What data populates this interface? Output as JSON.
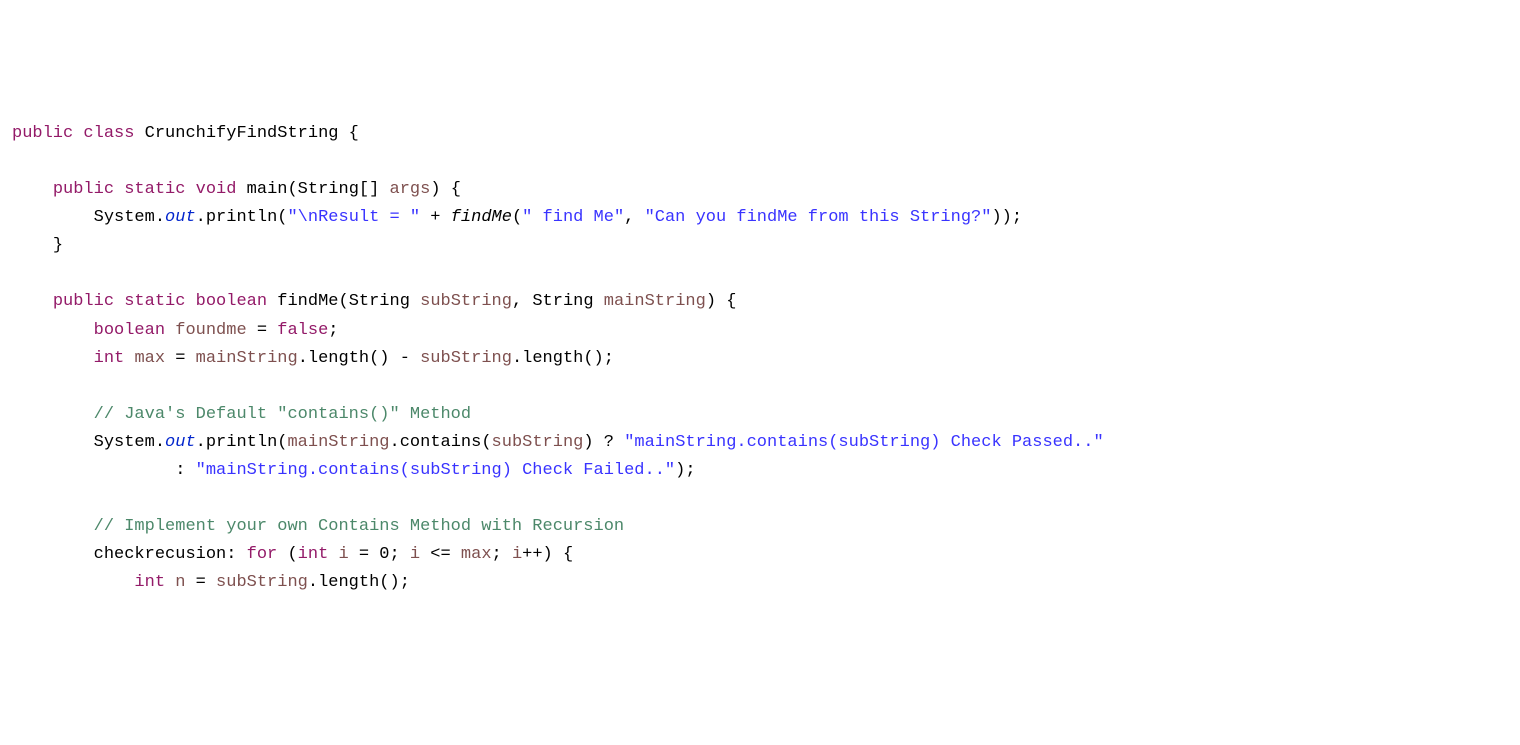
{
  "code": {
    "kw_public1": "public",
    "kw_class": "class",
    "classname": "CrunchifyFindString",
    "brace_open1": " {",
    "blank": "",
    "indent1": "    ",
    "kw_public2": "public",
    "kw_static1": "static",
    "kw_void": "void",
    "main_name": "main",
    "main_params_open": "(String[] ",
    "args": "args",
    "main_params_close": ") {",
    "indent2": "        ",
    "system1": "System.",
    "out1": "out",
    "println1": ".println(",
    "str1": "\"\\nResult = \"",
    "plus1": " + ",
    "findMe_call": "findMe",
    "call_open": "(",
    "str2": "\" find Me\"",
    "comma1": ", ",
    "str3": "\"Can you findMe from this String?\"",
    "call_close": "));",
    "close_brace1": "}",
    "kw_public3": "public",
    "kw_static2": "static",
    "kw_boolean": "boolean",
    "findMe_name": "findMe",
    "findMe_open": "(String ",
    "subString": "subString",
    "comma2": ", String ",
    "mainString": "mainString",
    "findMe_close": ") {",
    "kw_boolean2": "boolean",
    "foundme": "foundme",
    "eq_false": " = ",
    "kw_false": "false",
    "semi1": ";",
    "kw_int1": "int",
    "max": "max",
    "eq1": " = ",
    "mainString2": "mainString",
    "length1": ".length() - ",
    "subString2": "subString",
    "length2": ".length();",
    "comment1": "// Java's Default \"contains()\" Method",
    "system2": "System.",
    "out2": "out",
    "println2": ".println(",
    "mainString3": "mainString",
    "contains1": ".contains(",
    "subString3": "subString",
    "ternary1": ") ? ",
    "str4": "\"mainString.contains(subString) Check Passed..\"",
    "indent3": "                ",
    "colon1": ": ",
    "str5": "\"mainString.contains(subString) Check Failed..\"",
    "close_paren1": ");",
    "comment2": "// Implement your own Contains Method with Recursion",
    "label1": "checkrecusion: ",
    "kw_for": "for",
    "for_open": " (",
    "kw_int2": "int",
    "i1": "i",
    "eq2": " = 0; ",
    "i2": "i",
    "lte": " <= ",
    "max2": "max",
    "semi2": "; ",
    "i3": "i",
    "inc": "++) {",
    "indent4": "            ",
    "kw_int3": "int",
    "n": "n",
    "eq3": " = ",
    "subString4": "subString",
    "length3": ".length();"
  }
}
